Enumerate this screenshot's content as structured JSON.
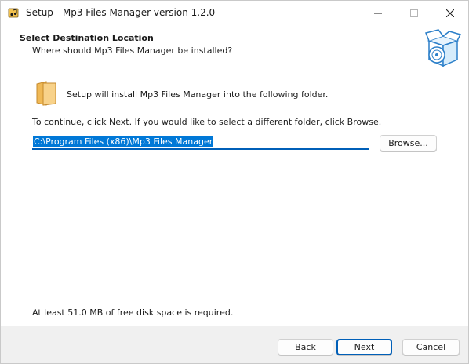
{
  "window": {
    "title": "Setup - Mp3 Files Manager version 1.2.0",
    "controls": {
      "minimize": "minimize-icon",
      "maximize": "maximize-icon",
      "close": "close-icon"
    }
  },
  "header": {
    "title": "Select Destination Location",
    "subtitle": "Where should Mp3 Files Manager be installed?",
    "graphic": "installer-box-icon"
  },
  "body": {
    "intro": "Setup will install Mp3 Files Manager into the following folder.",
    "instruction": "To continue, click Next. If you would like to select a different folder, click Browse.",
    "path_value": "C:\\Program Files (x86)\\Mp3 Files Manager",
    "browse_label": "Browse...",
    "disk_space": "At least 51.0 MB of free disk space is required."
  },
  "footer": {
    "back_label": "Back",
    "next_label": "Next",
    "cancel_label": "Cancel"
  },
  "colors": {
    "accent": "#005fb8",
    "selection": "#0078d7",
    "folder": "#f5c46a",
    "footer_bg": "#f0f0f0"
  }
}
